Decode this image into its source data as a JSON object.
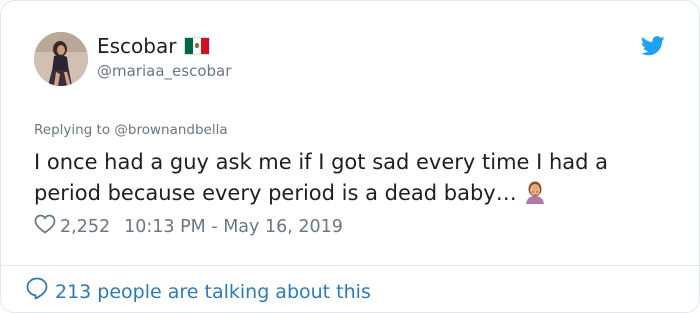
{
  "tweet": {
    "display_name": "Escobar",
    "handle": "@mariaa_escobar",
    "reply_prefix": "Replying to ",
    "reply_to": "@brownandbella",
    "text": "I once had a guy ask me if I got sad every time I had a period because every period is a dead baby…",
    "likes": "2,252",
    "timestamp": "10:13 PM - May 16, 2019",
    "talking_label": "213 people are talking about this"
  },
  "icons": {
    "flag": "mexico-flag-icon",
    "bird": "twitter-bird-icon",
    "emoji": "facepalm-emoji-icon",
    "heart": "heart-icon",
    "bubble": "comment-bubble-icon"
  },
  "colors": {
    "link": "#2b7bb9",
    "muted": "#697882",
    "text": "#1c2022",
    "twitter_blue": "#1da1f2"
  }
}
